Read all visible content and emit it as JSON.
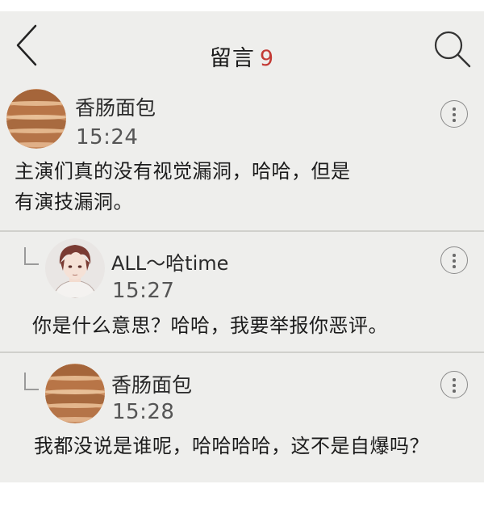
{
  "header": {
    "title": "留言",
    "count": "9",
    "back_icon": "chevron-left-icon",
    "search_icon": "search-icon"
  },
  "comments": [
    {
      "username": "香肠面包",
      "time": "15:24",
      "lines": [
        "主演们真的没有视觉漏洞，哈哈，但是",
        "有演技漏洞。"
      ],
      "avatar": "sausage-bread-avatar"
    },
    {
      "username": "ALL～哈time",
      "time": "15:27",
      "lines": [
        "你是什么意思？哈哈，我要举报你恶评。"
      ],
      "avatar": "anime-boy-avatar"
    },
    {
      "username": "香肠面包",
      "time": "15:28",
      "lines": [
        "我都没说是谁呢，哈哈哈哈，这不是自爆吗？"
      ],
      "avatar": "sausage-bread-avatar"
    }
  ],
  "colors": {
    "background": "#eeeeec",
    "count_accent": "#c33a35",
    "divider": "#d0d0cc"
  }
}
